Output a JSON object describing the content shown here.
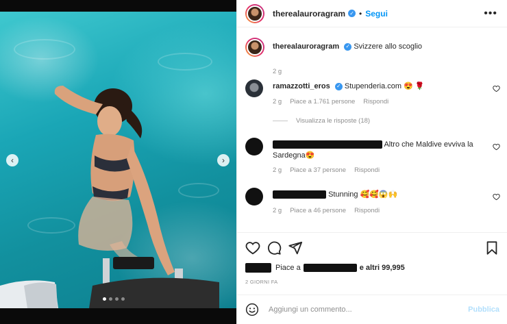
{
  "post": {
    "author": "therealauroragram",
    "follow_label": "Segui",
    "bullet": "•",
    "more_label": "•••"
  },
  "caption": {
    "username": "therealauroragram",
    "text": "Svizzere allo scoglio",
    "age": "2 g"
  },
  "comments": [
    {
      "username": "ramazzotti_eros",
      "text": "Stupenderia.com 😍 🌹",
      "age": "2 g",
      "likes": "Piace a 1.761 persone",
      "reply_label": "Rispondi",
      "view_replies": "Visualizza le risposte (18)"
    },
    {
      "text": "Altro che Maldive evviva la Sardegna😍",
      "age": "2 g",
      "likes": "Piace a 37 persone",
      "reply_label": "Rispondi"
    },
    {
      "text": "Stunning 🥰🥰😱🙌",
      "age": "2 g",
      "likes": "Piace a 46 persone",
      "reply_label": "Rispondi"
    }
  ],
  "likes_summary": {
    "prefix": "Piace a",
    "suffix": "e altri 99,995"
  },
  "date_label": "2 GIORNI FA",
  "comment_box": {
    "placeholder": "Aggiungi un commento...",
    "publish_label": "Pubblica"
  },
  "carousel": {
    "prev": "‹",
    "next": "›",
    "dot_count": 4,
    "active_dot": 0
  },
  "colors": {
    "accent": "#0095f6",
    "verified": "#3897f0",
    "water": "#1aa6b6"
  }
}
